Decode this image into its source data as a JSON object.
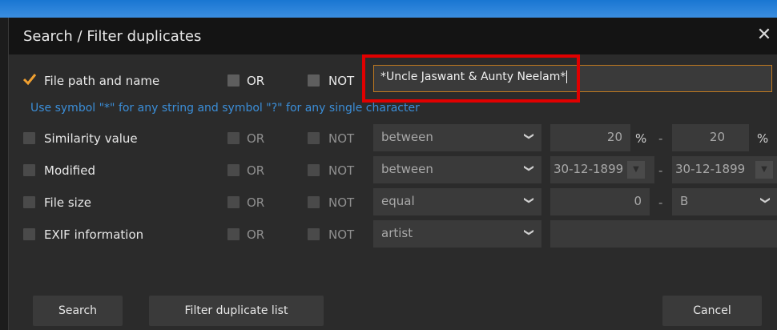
{
  "dialog": {
    "title": "Search / Filter duplicates",
    "close_icon": "close-icon"
  },
  "rows": {
    "path": {
      "label": "File path and name",
      "or": "OR",
      "not": "NOT",
      "value": "*Uncle Jaswant & Aunty Neelam*"
    },
    "hint": "Use symbol \"*\" for any string and symbol \"?\" for any single character",
    "similarity": {
      "label": "Similarity value",
      "or": "OR",
      "not": "NOT",
      "op": "between",
      "from": "20",
      "to": "20",
      "unit": "%"
    },
    "modified": {
      "label": "Modified",
      "or": "OR",
      "not": "NOT",
      "op": "between",
      "from": "30-12-1899",
      "to": "30-12-1899"
    },
    "filesize": {
      "label": "File size",
      "or": "OR",
      "not": "NOT",
      "op": "equal",
      "value": "0",
      "unit": "B"
    },
    "exif": {
      "label": "EXIF information",
      "or": "OR",
      "not": "NOT",
      "op": "artist"
    }
  },
  "dash": "-",
  "buttons": {
    "search": "Search",
    "filter": "Filter duplicate list",
    "cancel": "Cancel"
  },
  "colors": {
    "accent_orange": "#f0a030",
    "hint_blue": "#3b8ed8",
    "highlight_red": "#e00000"
  }
}
